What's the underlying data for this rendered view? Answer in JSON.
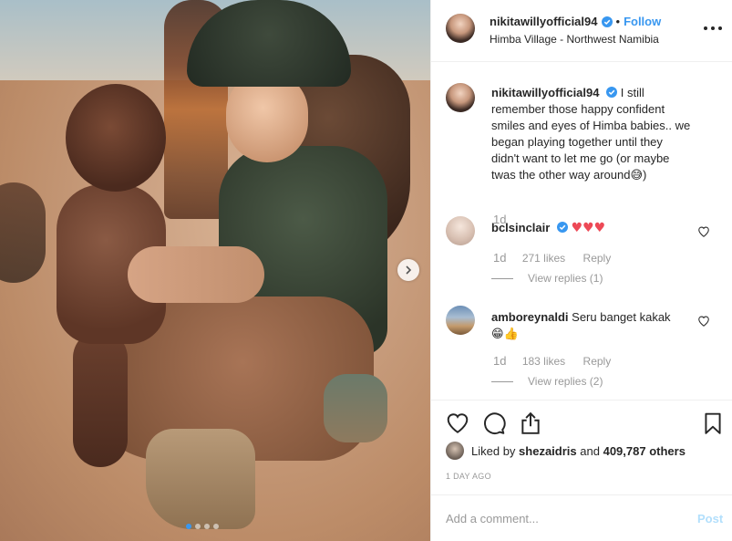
{
  "post": {
    "author": "nikitawillyofficial94",
    "location": "Himba Village - Northwest Namibia",
    "follow_label": "Follow",
    "separator": "•"
  },
  "caption": {
    "author": "nikitawillyofficial94",
    "text": "I still remember those happy confident smiles and eyes of Himba babies.. we began playing together until they didn't want to let me go (or maybe twas the other way around",
    "emoji_end": "😅",
    "closing": ")",
    "time": "1d"
  },
  "comments": [
    {
      "author": "bclsinclair",
      "text": "♥♥♥",
      "time": "1d",
      "likes": "271 likes",
      "reply_label": "Reply",
      "view_replies": "View replies (1)"
    },
    {
      "author": "amboreynaldi",
      "text": "Seru banget kakak",
      "emoji": "😁👍",
      "time": "1d",
      "likes": "183 likes",
      "reply_label": "Reply",
      "view_replies": "View replies (2)"
    }
  ],
  "likes": {
    "prefix": "Liked by",
    "user": "shezaidris",
    "and": "and",
    "count": "409,787 others"
  },
  "posted": "1 DAY AGO",
  "add_comment": {
    "placeholder": "Add a comment...",
    "post_label": "Post"
  },
  "colors": {
    "accent": "#3897f0",
    "heart": "#ed4956",
    "muted": "#999999",
    "post_disabled": "#b2dffc"
  },
  "icons": [
    "verified-badge-icon",
    "more-options-icon",
    "heart-outline-icon",
    "comment-icon",
    "share-icon",
    "bookmark-icon",
    "carousel-next-icon"
  ]
}
